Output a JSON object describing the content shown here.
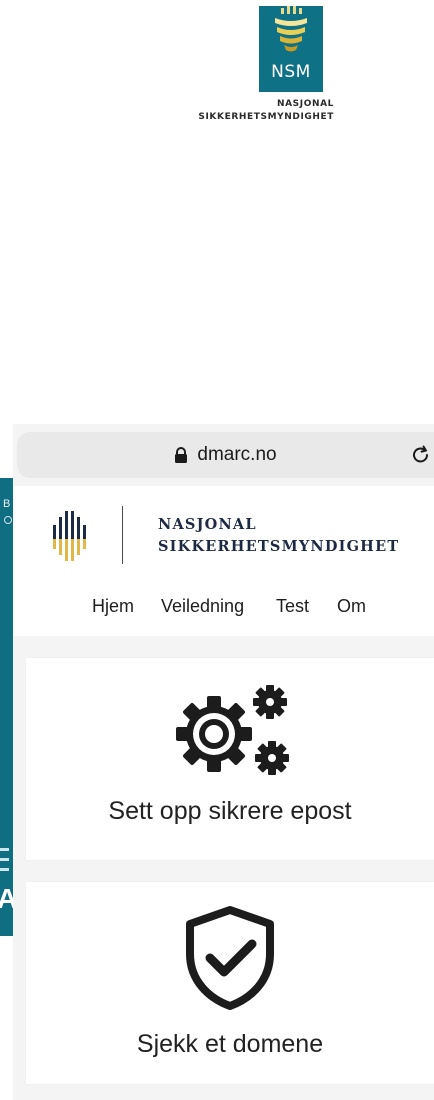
{
  "nsm_badge": {
    "abbreviation": "NSM",
    "caption_line1": "NASJONAL",
    "caption_line2": "SIKKERHETSMYNDIGHET",
    "color": "#0f7186"
  },
  "browser": {
    "url": "dmarc.no",
    "icons": [
      "lock-icon",
      "reload-icon"
    ]
  },
  "site": {
    "logo_line1": "NASJONAL",
    "logo_line2": "SIKKERHETSMYNDIGHET",
    "nav": [
      "Hjem",
      "Veiledning",
      "Test",
      "Om"
    ],
    "cards": [
      {
        "title": "Sett opp sikrere epost",
        "icon": "gears-icon"
      },
      {
        "title": "Sjekk et domene",
        "icon": "shield-check-icon"
      }
    ]
  },
  "colors": {
    "teal": "#0f7186",
    "gold": "#e0b84a",
    "navy": "#1d2a44"
  }
}
